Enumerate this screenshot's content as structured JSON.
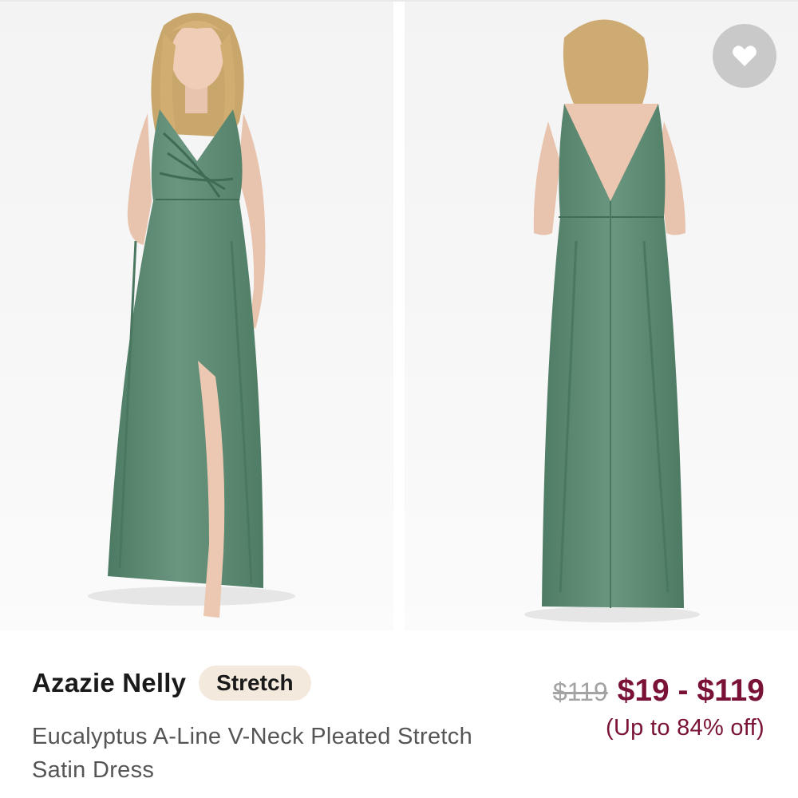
{
  "product": {
    "name": "Azazie Nelly",
    "badge": "Stretch",
    "description": "Eucalyptus A-Line V-Neck Pleated Stretch Satin Dress",
    "original_price": "$119",
    "price_range": "$19 - $119",
    "discount": "(Up to 84% off)"
  },
  "gallery": {
    "images": [
      {
        "icon": "dress-front-photo"
      },
      {
        "icon": "dress-back-photo"
      }
    ]
  },
  "favorite": {
    "icon": "heart-icon"
  },
  "colors": {
    "dress": "#5e8a72",
    "price": "#7a1238",
    "badge_bg": "#f3e9dd",
    "favorite_bg": "#c9c9c9"
  }
}
